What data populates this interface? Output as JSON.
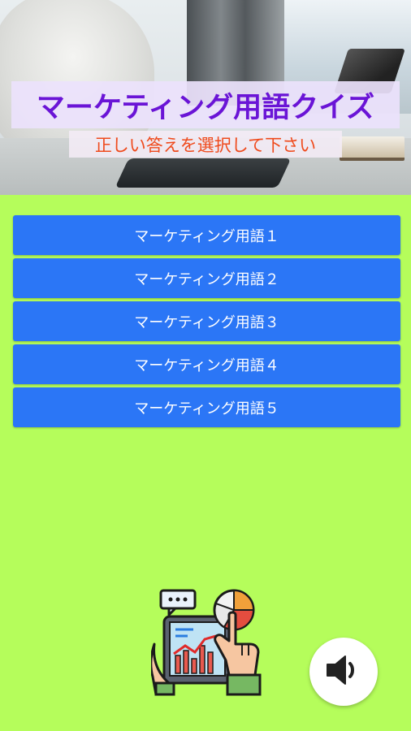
{
  "header": {
    "title": "マーケティング用語クイズ",
    "subtitle": "正しい答えを選択して下さい"
  },
  "menu": {
    "items": [
      {
        "label": "マーケティング用語１"
      },
      {
        "label": "マーケティング用語２"
      },
      {
        "label": "マーケティング用語３"
      },
      {
        "label": "マーケティング用語４"
      },
      {
        "label": "マーケティング用語５"
      }
    ]
  },
  "icons": {
    "illustration": "marketing-analytics-illustration",
    "sound": "speaker-icon"
  },
  "colors": {
    "background": "#b5fd5b",
    "button": "#2b76f6",
    "title": "#6a14d6",
    "subtitle": "#ef4a1c"
  }
}
